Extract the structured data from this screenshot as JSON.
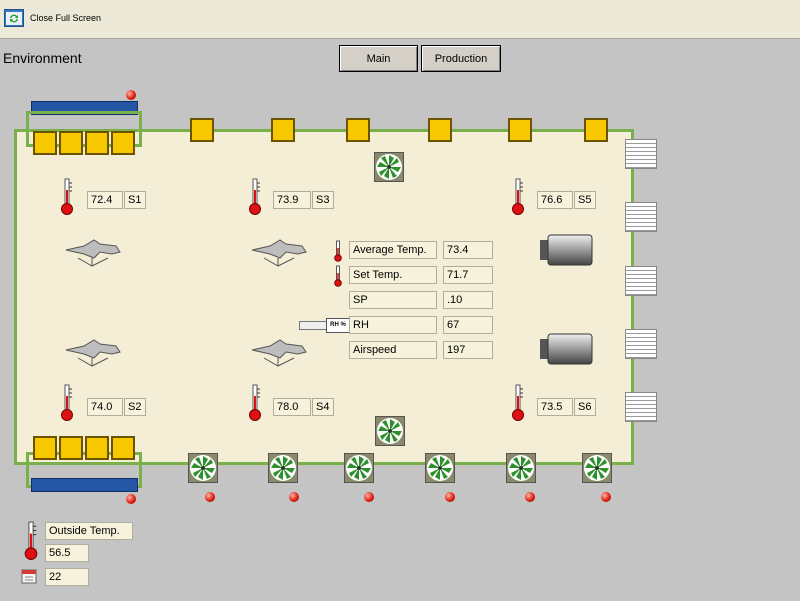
{
  "toolbar": {
    "close_label": "Close Full Screen",
    "icon": "screen-refresh-icon"
  },
  "page_title": "Environment",
  "nav": {
    "main_label": "Main",
    "production_label": "Production"
  },
  "sensors": [
    {
      "value": "72.4",
      "label": "S1"
    },
    {
      "value": "73.9",
      "label": "S3"
    },
    {
      "value": "76.6",
      "label": "S5"
    },
    {
      "value": "74.0",
      "label": "S2"
    },
    {
      "value": "78.0",
      "label": "S4"
    },
    {
      "value": "73.5",
      "label": "S6"
    }
  ],
  "readings": {
    "average_temp": {
      "label": "Average Temp.",
      "value": "73.4"
    },
    "set_temp": {
      "label": "Set Temp.",
      "value": "71.7"
    },
    "sp": {
      "label": "SP",
      "value": ".10"
    },
    "rh": {
      "label": "RH",
      "value": "67",
      "icon_text": "RH %"
    },
    "airspeed": {
      "label": "Airspeed",
      "value": "197"
    }
  },
  "outside": {
    "label": "Outside Temp.",
    "value": "56.5",
    "count": "22"
  },
  "colors": {
    "floor": "#f4eed6",
    "wall": "#79b04a",
    "heater": "#f7c800",
    "bar": "#2657a6",
    "led": "#e02010"
  }
}
